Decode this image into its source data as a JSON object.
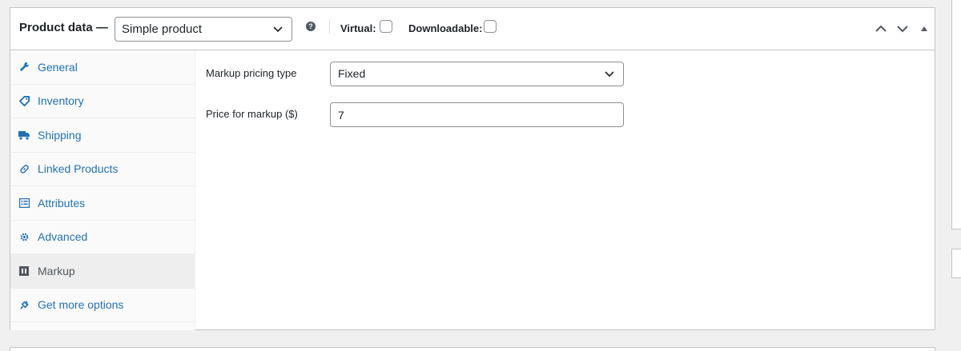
{
  "header": {
    "title": "Product data —",
    "product_type": "Simple product",
    "help_glyph": "?",
    "virtual_label": "Virtual:",
    "downloadable_label": "Downloadable:"
  },
  "tabs": [
    {
      "label": "General",
      "icon": "wrench-icon"
    },
    {
      "label": "Inventory",
      "icon": "tag-icon"
    },
    {
      "label": "Shipping",
      "icon": "truck-icon"
    },
    {
      "label": "Linked Products",
      "icon": "link-icon"
    },
    {
      "label": "Attributes",
      "icon": "list-icon"
    },
    {
      "label": "Advanced",
      "icon": "gear-icon"
    },
    {
      "label": "Markup",
      "icon": "markup-icon",
      "active": true
    },
    {
      "label": "Get more options",
      "icon": "plugin-icon"
    }
  ],
  "panel": {
    "pricing_type_label": "Markup pricing type",
    "pricing_type_value": "Fixed",
    "price_label": "Price for markup ($)",
    "price_value": "7"
  },
  "colors": {
    "link": "#2271b1",
    "border": "#c3c4c7",
    "active_tab_bg": "#eeeeee"
  }
}
